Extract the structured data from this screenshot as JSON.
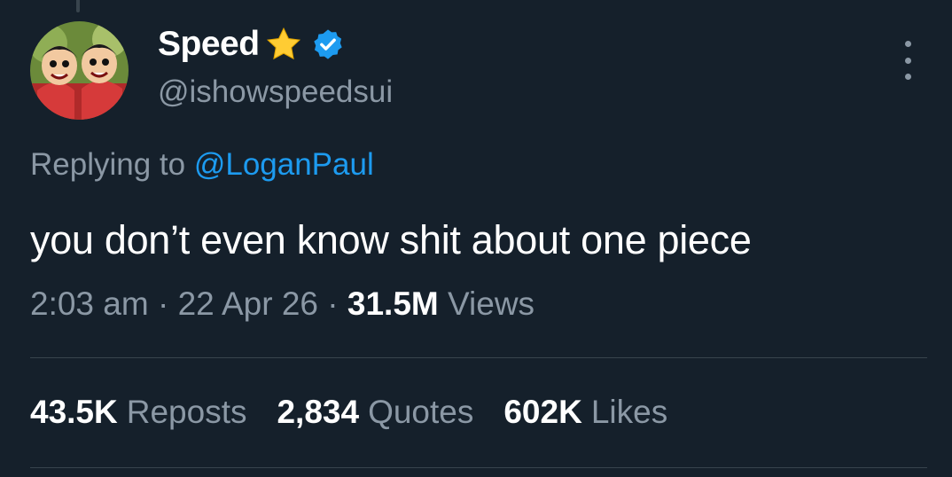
{
  "tweet": {
    "display_name": "Speed",
    "handle": "@ishowspeedsui",
    "reply_prefix": "Replying to ",
    "reply_mention": "@LoganPaul",
    "text": "you don’t even know shit about one piece",
    "time": "2:03 am",
    "separator": "·",
    "date": "22 Apr 26",
    "views_count": "31.5M",
    "views_label": "Views"
  },
  "stats": [
    {
      "count": "43.5K",
      "label": "Reposts"
    },
    {
      "count": "2,834",
      "label": "Quotes"
    },
    {
      "count": "602K",
      "label": "Likes"
    }
  ],
  "icons": {
    "name_emoji": "star-icon",
    "badge": "verified-icon",
    "menu": "more-icon"
  },
  "colors": {
    "background": "#15202b",
    "accent": "#1d9bf0",
    "muted": "#8b98a5",
    "star": "#ffcc33"
  }
}
